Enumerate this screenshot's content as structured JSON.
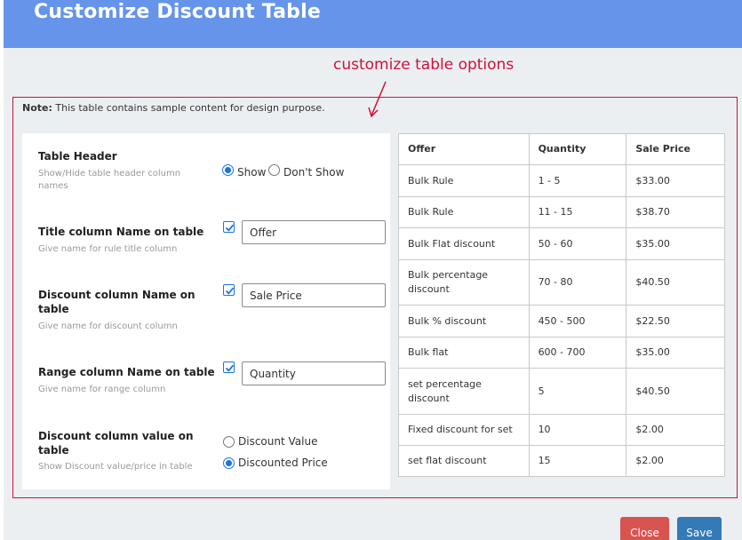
{
  "modal": {
    "title": "Customize Discount Table"
  },
  "annotation": {
    "text": "customize table options"
  },
  "note": {
    "label": "Note:",
    "text": " This table contains sample content for design purpose."
  },
  "settings": {
    "table_header": {
      "title": "Table Header",
      "help": "Show/Hide table header column names",
      "options": [
        "Show",
        "Don't Show"
      ],
      "selected": "Show"
    },
    "title_column": {
      "title": "Title column Name on table",
      "help": "Give name for rule title column",
      "checked": true,
      "value": "Offer"
    },
    "discount_column": {
      "title": "Discount column Name on table",
      "help": "Give name for discount column",
      "checked": true,
      "value": "Sale Price"
    },
    "range_column": {
      "title": "Range column Name on table",
      "help": "Give name for range column",
      "checked": true,
      "value": "Quantity"
    },
    "discount_value": {
      "title": "Discount column value on table",
      "help": "Show Discount value/price in table",
      "options": [
        "Discount Value",
        "Discounted Price"
      ],
      "selected": "Discounted Price"
    }
  },
  "table": {
    "headers": [
      "Offer",
      "Quantity",
      "Sale Price"
    ],
    "rows": [
      [
        "Bulk Rule",
        "1 - 5",
        "$33.00"
      ],
      [
        "Bulk Rule",
        "11 - 15",
        "$38.70"
      ],
      [
        "Bulk Flat discount",
        "50 - 60",
        "$35.00"
      ],
      [
        "Bulk percentage discount",
        "70 - 80",
        "$40.50"
      ],
      [
        "Bulk % discount",
        "450 - 500",
        "$22.50"
      ],
      [
        "Bulk flat",
        "600 - 700",
        "$35.00"
      ],
      [
        "set percentage discount",
        "5",
        "$40.50"
      ],
      [
        "Fixed discount for set",
        "10",
        "$2.00"
      ],
      [
        "set flat discount",
        "15",
        "$2.00"
      ]
    ]
  },
  "buttons": {
    "close": "Close",
    "save": "Save"
  },
  "colors": {
    "header": "#6594ea",
    "annotation": "#d0103a",
    "close": "#d9534f",
    "save": "#337ab7"
  }
}
